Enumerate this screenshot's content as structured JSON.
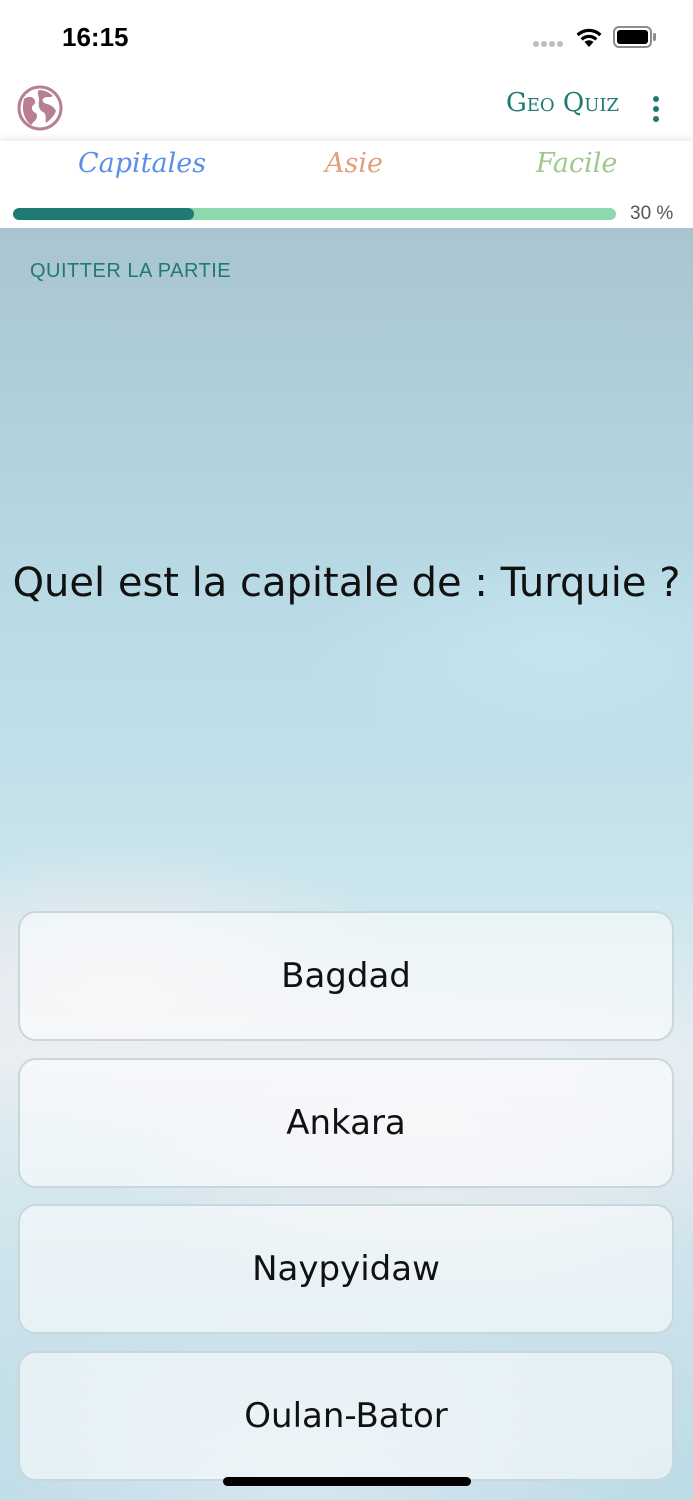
{
  "status_bar": {
    "time": "16:15"
  },
  "app_bar": {
    "logo_icon": "globe-icon",
    "title": "Geo Quiz",
    "menu_icon": "more-vertical-icon"
  },
  "categories": {
    "type": "Capitales",
    "region": "Asie",
    "difficulty": "Facile"
  },
  "progress": {
    "value": 0.3,
    "label": "30 %"
  },
  "quiz": {
    "quit_label": "QUITTER LA PARTIE",
    "question": "Quel est la capitale de : Turquie ?",
    "answers": [
      "Bagdad",
      "Ankara",
      "Naypyidaw",
      "Oulan-Bator"
    ]
  },
  "colors": {
    "accent": "#1f7a72",
    "progress_track": "#8ed8ad",
    "category_type": "#5a8fe6",
    "category_region": "#e0a07e",
    "category_difficulty": "#9ec98a",
    "logo": "#b77f93"
  }
}
